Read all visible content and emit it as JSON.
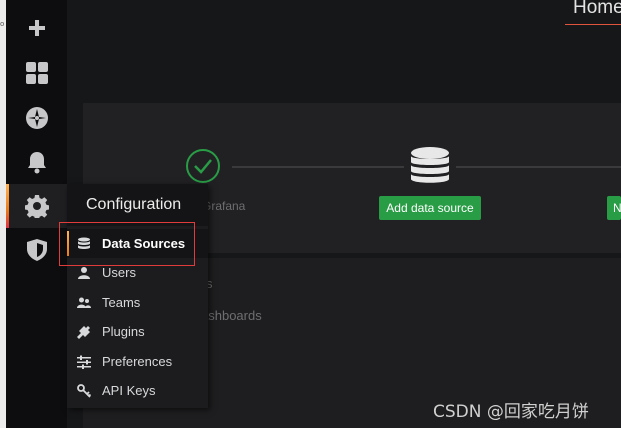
{
  "browser_edge": {
    "char": "o"
  },
  "sidebar": {
    "items": [
      {
        "name": "create",
        "icon": "plus-icon"
      },
      {
        "name": "dashboards",
        "icon": "dashboards-grid-icon"
      },
      {
        "name": "explore",
        "icon": "compass-icon"
      },
      {
        "name": "alerting",
        "icon": "bell-icon"
      },
      {
        "name": "configuration",
        "icon": "gear-icon",
        "active": true
      },
      {
        "name": "server-admin",
        "icon": "shield-icon"
      }
    ]
  },
  "header": {
    "title": "Home"
  },
  "getting_started": {
    "step1_label": "Grafana",
    "add_data_source_label": "Add data source",
    "next_button_partial": "N"
  },
  "behind_text": {
    "line1": "s",
    "line2": "ashboards"
  },
  "config_menu": {
    "title": "Configuration",
    "items": [
      {
        "label": "Data Sources",
        "icon": "database-icon",
        "selected": true
      },
      {
        "label": "Users",
        "icon": "user-icon"
      },
      {
        "label": "Teams",
        "icon": "users-icon"
      },
      {
        "label": "Plugins",
        "icon": "plug-icon"
      },
      {
        "label": "Preferences",
        "icon": "sliders-icon"
      },
      {
        "label": "API Keys",
        "icon": "key-icon"
      }
    ]
  },
  "watermark": "CSDN @回家吃月饼",
  "colors": {
    "accent_orange": "#eb7b18",
    "success_green": "#299c46",
    "highlight_red": "#e03c3c"
  }
}
